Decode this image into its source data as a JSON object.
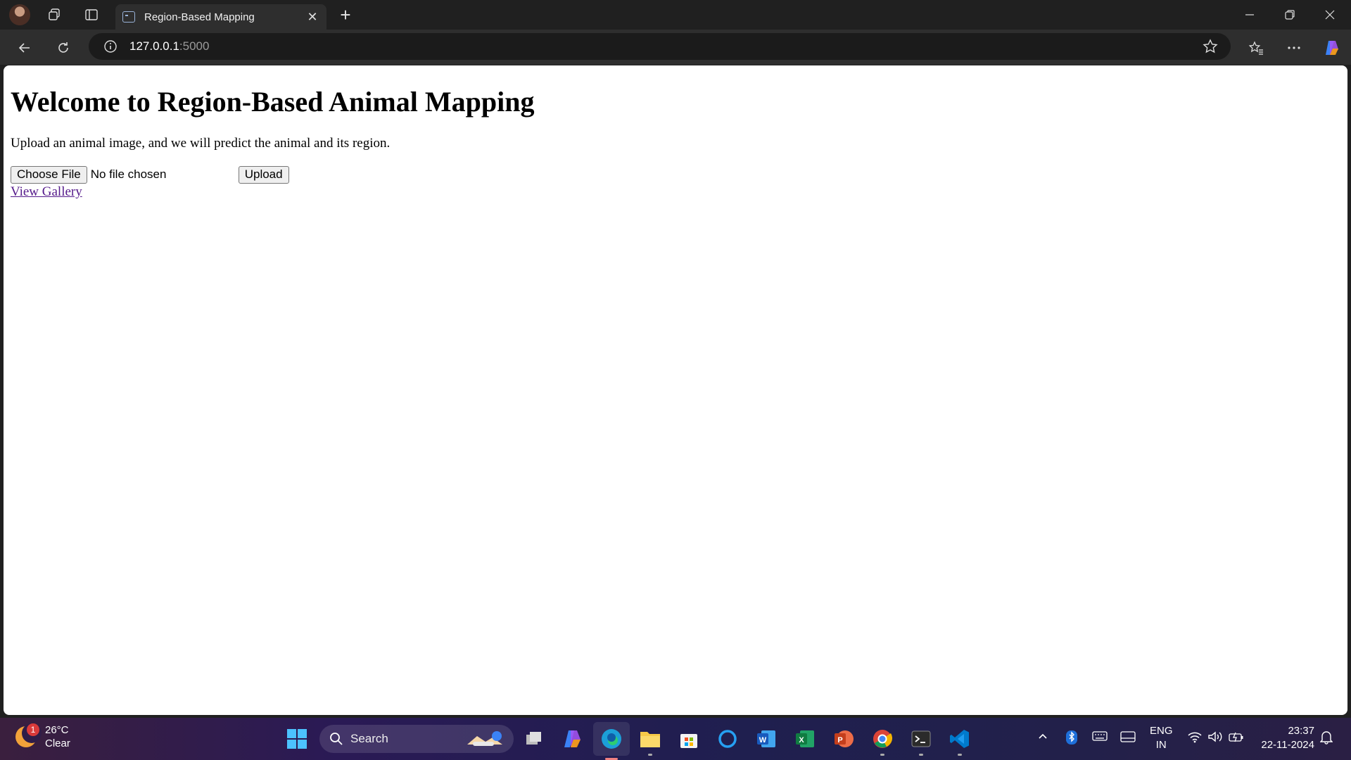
{
  "browser": {
    "tab": {
      "title": "Region-Based Mapping"
    },
    "address": {
      "host": "127.0.0.1",
      "port": ":5000"
    }
  },
  "page": {
    "heading": "Welcome to Region-Based Animal Mapping",
    "description": "Upload an animal image, and we will predict the animal and its region.",
    "file_input": {
      "button_label": "Choose File",
      "status": "No file chosen"
    },
    "upload_label": "Upload",
    "gallery_link": "View Gallery"
  },
  "taskbar": {
    "weather": {
      "temp": "26°C",
      "condition": "Clear",
      "badge": "1"
    },
    "search_label": "Search",
    "language": {
      "line1": "ENG",
      "line2": "IN"
    },
    "clock": {
      "time": "23:37",
      "date": "22-11-2024"
    }
  }
}
